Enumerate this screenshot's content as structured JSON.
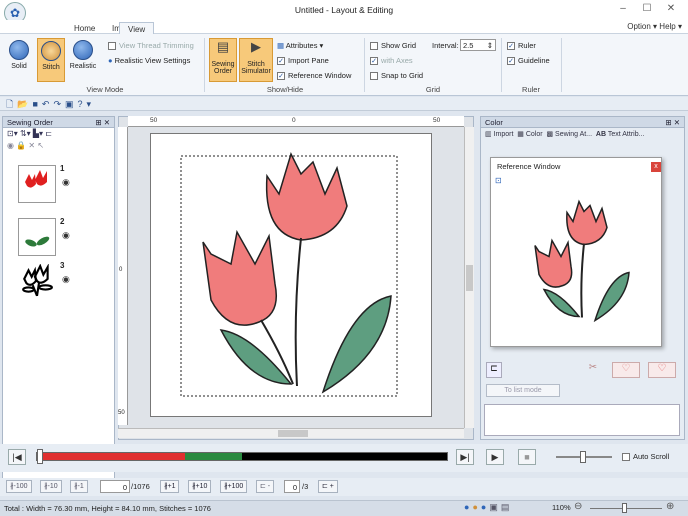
{
  "window": {
    "title": "Untitled - Layout & Editing",
    "minimize": "–",
    "maximize": "☐",
    "close": "✕"
  },
  "tabs": [
    {
      "label": "Home"
    },
    {
      "label": "Image"
    },
    {
      "label": "View"
    }
  ],
  "top_right": {
    "option": "Option",
    "help": "Help"
  },
  "ribbon": {
    "view_mode": {
      "label": "View Mode",
      "solid": "Solid",
      "stitch": "Stitch",
      "realistic": "Realistic",
      "thread_trimming": "View Thread Trimming",
      "realistic_settings": "Realistic View Settings"
    },
    "show_hide": {
      "label": "Show/Hide",
      "sewing_order": "Sewing Order",
      "stitch_simulator": "Stitch Simulator",
      "attributes": "Attributes",
      "import_pane": "Import Pane",
      "reference_window": "Reference Window"
    },
    "grid": {
      "label": "Grid",
      "show_grid": "Show Grid",
      "interval_label": "Interval:",
      "interval_value": "2.5",
      "with_axes": "with Axes",
      "snap_to_grid": "Snap to Grid"
    },
    "ruler": {
      "label": "Ruler",
      "ruler": "Ruler",
      "guideline": "Guideline"
    }
  },
  "sewing_order": {
    "title": "Sewing Order",
    "items": [
      {
        "num": "1"
      },
      {
        "num": "2"
      },
      {
        "num": "3"
      }
    ]
  },
  "ruler": {
    "h_ticks": [
      "50",
      "0",
      "50"
    ],
    "v_ticks": [
      "0",
      "50"
    ]
  },
  "color_panel": {
    "title": "Color",
    "tabs": [
      "Import",
      "Color",
      "Sewing At...",
      "Text Attrib..."
    ],
    "to_list_mode": "To list mode"
  },
  "reference_window": {
    "title": "Reference Window",
    "close": "x"
  },
  "playback": {
    "auto_scroll": "Auto Scroll",
    "progress_fraction": 0.36
  },
  "steps": {
    "b100": "-100",
    "b10": "-10",
    "b1": "-1",
    "current": "0",
    "total": "/1076",
    "f1": "+1",
    "f10": "+10",
    "f100": "+100",
    "page_current": "0",
    "page_total": "/3"
  },
  "status": {
    "text": "Total : Width = 76.30 mm, Height = 84.10 mm, Stitches = 1076",
    "zoom": "110%"
  },
  "colors": {
    "accent": "#f7c97a",
    "red": "#e05a5a",
    "green": "#3e8a5c"
  }
}
